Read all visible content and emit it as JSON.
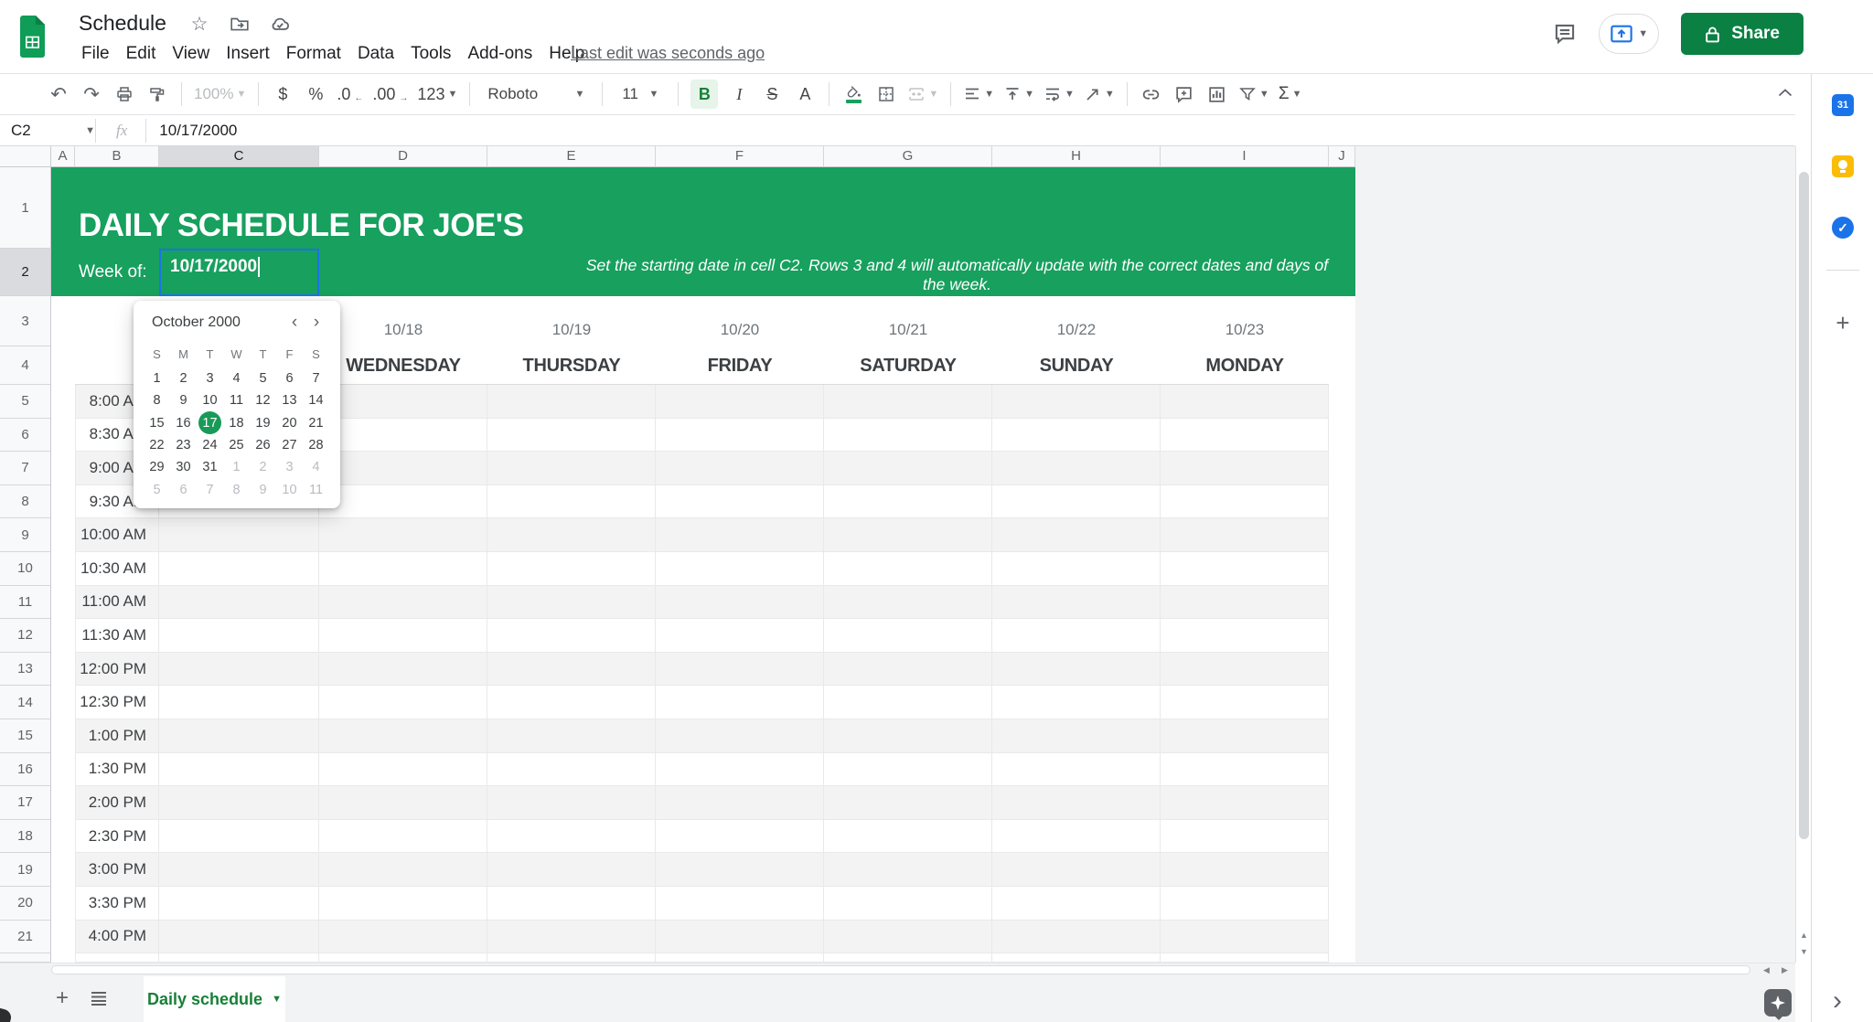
{
  "colors": {
    "band_green": "#17a05e",
    "share_green": "#0b8043",
    "tab_green": "#188038",
    "selection_blue": "#1a73e8",
    "logo_green": "#0f9d58"
  },
  "titlebar": {
    "title": "Schedule",
    "menus": [
      "File",
      "Edit",
      "View",
      "Insert",
      "Format",
      "Data",
      "Tools",
      "Add-ons",
      "Help"
    ],
    "last_edit": "Last edit was seconds ago",
    "share_label": "Share"
  },
  "toolbar": {
    "zoom": "100%",
    "currency": "$",
    "percent": "%",
    "decrease_decimal": ".0",
    "increase_decimal": ".00",
    "number_format": "123",
    "font": "Roboto",
    "font_size": "11",
    "bold": "B",
    "italic": "I",
    "strikethrough": "S",
    "text_color": "A",
    "functions": "Σ"
  },
  "formula_bar": {
    "ref": "C2",
    "fx": "fx",
    "value": "10/17/2000"
  },
  "grid": {
    "columns": [
      "A",
      "B",
      "C",
      "D",
      "E",
      "F",
      "G",
      "H",
      "I",
      "J"
    ],
    "rows": [
      "1",
      "2",
      "3",
      "4",
      "5",
      "6",
      "7",
      "8",
      "9",
      "10",
      "11",
      "12",
      "13",
      "14",
      "15",
      "16",
      "17",
      "18",
      "19",
      "20",
      "21"
    ]
  },
  "sheet": {
    "title": "DAILY SCHEDULE FOR JOE'S",
    "week_label": "Week of:",
    "week_value": "10/17/2000",
    "instruction": "Set the starting date in cell C2. Rows 3 and 4 will automatically update with the correct dates and days of the week.",
    "days": [
      {
        "date": "10/18",
        "day": "WEDNESDAY"
      },
      {
        "date": "10/19",
        "day": "THURSDAY"
      },
      {
        "date": "10/20",
        "day": "FRIDAY"
      },
      {
        "date": "10/21",
        "day": "SATURDAY"
      },
      {
        "date": "10/22",
        "day": "SUNDAY"
      },
      {
        "date": "10/23",
        "day": "MONDAY"
      }
    ],
    "times": [
      "8:00 AM",
      "8:30 AM",
      "9:00 AM",
      "9:30 AM",
      "10:00 AM",
      "10:30 AM",
      "11:00 AM",
      "11:30 AM",
      "12:00 PM",
      "12:30 PM",
      "1:00 PM",
      "1:30 PM",
      "2:00 PM",
      "2:30 PM",
      "3:00 PM",
      "3:30 PM",
      "4:00 PM"
    ]
  },
  "date_picker": {
    "month": "October 2000",
    "weekdays": [
      "S",
      "M",
      "T",
      "W",
      "T",
      "F",
      "S"
    ],
    "weeks": [
      [
        {
          "d": "1"
        },
        {
          "d": "2"
        },
        {
          "d": "3"
        },
        {
          "d": "4"
        },
        {
          "d": "5"
        },
        {
          "d": "6"
        },
        {
          "d": "7"
        }
      ],
      [
        {
          "d": "8"
        },
        {
          "d": "9"
        },
        {
          "d": "10"
        },
        {
          "d": "11"
        },
        {
          "d": "12"
        },
        {
          "d": "13"
        },
        {
          "d": "14"
        }
      ],
      [
        {
          "d": "15"
        },
        {
          "d": "16"
        },
        {
          "d": "17",
          "selected": true
        },
        {
          "d": "18"
        },
        {
          "d": "19"
        },
        {
          "d": "20"
        },
        {
          "d": "21"
        }
      ],
      [
        {
          "d": "22"
        },
        {
          "d": "23"
        },
        {
          "d": "24"
        },
        {
          "d": "25"
        },
        {
          "d": "26"
        },
        {
          "d": "27"
        },
        {
          "d": "28"
        }
      ],
      [
        {
          "d": "29"
        },
        {
          "d": "30"
        },
        {
          "d": "31"
        },
        {
          "d": "1",
          "muted": true
        },
        {
          "d": "2",
          "muted": true
        },
        {
          "d": "3",
          "muted": true
        },
        {
          "d": "4",
          "muted": true
        }
      ],
      [
        {
          "d": "5",
          "muted": true
        },
        {
          "d": "6",
          "muted": true
        },
        {
          "d": "7",
          "muted": true
        },
        {
          "d": "8",
          "muted": true
        },
        {
          "d": "9",
          "muted": true
        },
        {
          "d": "10",
          "muted": true
        },
        {
          "d": "11",
          "muted": true
        }
      ]
    ]
  },
  "tabs": {
    "active": "Daily schedule"
  },
  "side_panel": {
    "calendar_label": "31"
  }
}
